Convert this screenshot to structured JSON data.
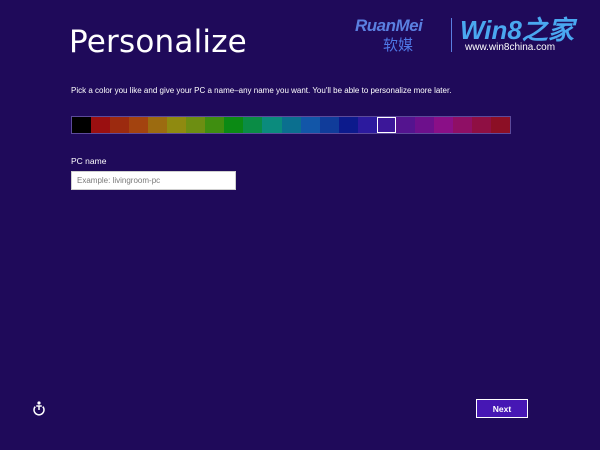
{
  "page": {
    "title": "Personalize",
    "description": "Pick a color you like and give your PC a name–any name you want. You'll be able to personalize more later."
  },
  "colors": {
    "background": "#1f0a5a",
    "swatches": [
      "#000000",
      "#9a0f10",
      "#9c2a0f",
      "#a3430f",
      "#9c6b10",
      "#8f8a10",
      "#6d8e12",
      "#3f8e10",
      "#0b8a14",
      "#0a8c45",
      "#0b8b7d",
      "#0b6f8f",
      "#1256a8",
      "#103c9a",
      "#0c1a8c",
      "#2c1a9e",
      "#3c1799",
      "#54148f",
      "#6d108c",
      "#8a0f87",
      "#8f0f65",
      "#8f0f43",
      "#8c0f25"
    ],
    "selected_index": 16
  },
  "pc_name": {
    "label": "PC name",
    "placeholder": "Example: livingroom-pc",
    "value": ""
  },
  "ease_of_access": {
    "icon": "ease-of-access-icon"
  },
  "buttons": {
    "next_label": "Next"
  },
  "watermarks": {
    "ruanmei_latin": "RuanMei",
    "ruanmei_cn": "软媒",
    "win8_main": "Win8之家",
    "win8_url": "www.win8china.com"
  }
}
